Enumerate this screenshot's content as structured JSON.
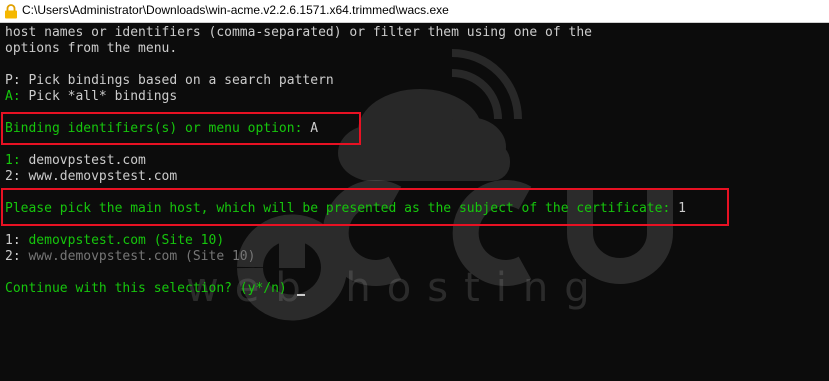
{
  "window": {
    "title": "C:\\Users\\Administrator\\Downloads\\win-acme.v2.2.6.1571.x64.trimmed\\wacs.exe",
    "icon": "lock-icon"
  },
  "console": {
    "intro_line1": "host names or identifiers (comma-separated) or filter them using one of the",
    "intro_line2": "options from the menu.",
    "opt_p_key": "P:",
    "opt_p_text": " Pick bindings based on a search pattern",
    "opt_a_key": "A:",
    "opt_a_text": " Pick *all* bindings",
    "prompt1_text": "Binding identifiers(s) or menu option: ",
    "prompt1_answer": "A",
    "list1_item1_num": "1:",
    "list1_item1_text": " demovpstest.com",
    "list1_item2_num": "2:",
    "list1_item2_text": " www.demovpstest.com",
    "prompt2_text": "Please pick the main host, which will be presented as the subject of the certificate: ",
    "prompt2_answer": "1",
    "list2_item1_num": "1:",
    "list2_item1_text": " demovpstest.com (Site 10)",
    "list2_item2_num": "2:",
    "list2_item2_text": " www.demovpstest.com (Site 10)",
    "prompt3_text": "Continue with this selection? (y*/n) "
  },
  "watermark": {
    "brand": "accu",
    "tagline": "web hosting"
  },
  "colors": {
    "background": "#0c0c0c",
    "text": "#cccccc",
    "green": "#16c60c",
    "dim": "#767676",
    "highlight": "#e81123"
  }
}
